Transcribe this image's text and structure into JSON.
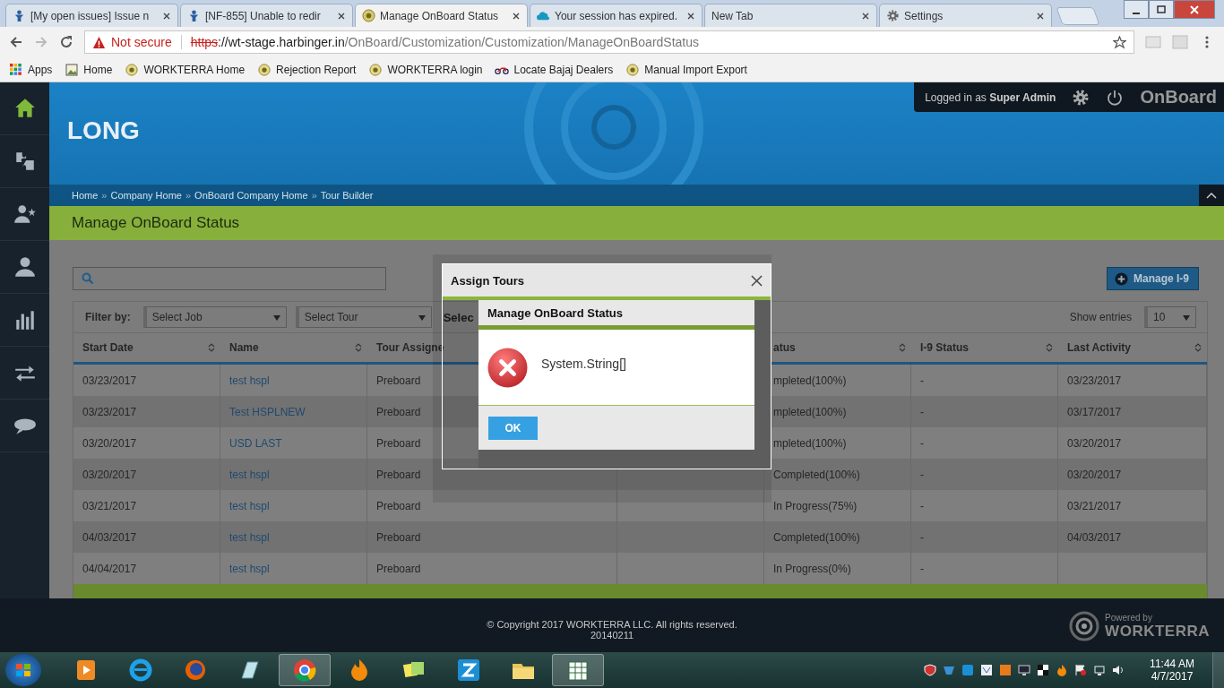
{
  "browser": {
    "tabs": [
      {
        "title": "[My open issues] Issue n",
        "kind": "figure",
        "selected": false
      },
      {
        "title": "[NF-855] Unable to redir",
        "kind": "figure",
        "selected": false
      },
      {
        "title": "Manage OnBoard Status",
        "kind": "logo",
        "selected": true
      },
      {
        "title": "Your session has expired.",
        "kind": "cloud",
        "selected": false
      },
      {
        "title": "New Tab",
        "kind": "plain",
        "selected": false
      },
      {
        "title": "Settings",
        "kind": "gear",
        "selected": false
      }
    ],
    "address": {
      "security": "Not secure",
      "scheme": "https",
      "host": "://wt-stage.harbinger.in",
      "path": "/OnBoard/Customization/Customization/ManageOnBoardStatus"
    },
    "bookmarks": [
      {
        "label": "Apps",
        "kind": "apps"
      },
      {
        "label": "Home",
        "kind": "page"
      },
      {
        "label": "WORKTERRA Home",
        "kind": "logo"
      },
      {
        "label": "Rejection Report",
        "kind": "logo"
      },
      {
        "label": "WORKTERRA login",
        "kind": "logo"
      },
      {
        "label": "Locate Bajaj Dealers",
        "kind": "bike"
      },
      {
        "label": "Manual Import Export",
        "kind": "logo"
      }
    ]
  },
  "sidebar": {
    "items": [
      {
        "kind": "home",
        "selected": true
      },
      {
        "kind": "puzzle",
        "selected": false
      },
      {
        "kind": "person-star",
        "selected": false
      },
      {
        "kind": "person",
        "selected": false
      },
      {
        "kind": "chart",
        "selected": false
      },
      {
        "kind": "arrows",
        "selected": false
      },
      {
        "kind": "chat",
        "selected": false
      }
    ]
  },
  "header": {
    "company": "LONG",
    "user_prefix": "Logged in as",
    "user": "Super Admin",
    "product": "OnBoard",
    "breadcrumbs": [
      "Home",
      "Company Home",
      "OnBoard Company Home",
      "Tour Builder"
    ],
    "separator": "»"
  },
  "page": {
    "title": "Manage OnBoard Status",
    "manage_button": "Manage I-9",
    "filter": {
      "label": "Filter by:",
      "selects": [
        "Select Job",
        "Select Tour",
        "Selec"
      ],
      "show_entries": "Show entries",
      "entries": "10"
    },
    "table": {
      "columns": [
        "Start Date",
        "Name",
        "Tour Assigne",
        "atus",
        "I-9 Status",
        "Last Activity"
      ],
      "rows": [
        {
          "start_date": "03/23/2017",
          "name": "test hspl",
          "tour": "Preboard",
          "status": "mpleted(100%)",
          "i9": "-",
          "last_activity": "03/23/2017"
        },
        {
          "start_date": "03/23/2017",
          "name": "Test HSPLNEW",
          "tour": "Preboard",
          "status": "mpleted(100%)",
          "i9": "-",
          "last_activity": "03/17/2017"
        },
        {
          "start_date": "03/20/2017",
          "name": "USD LAST",
          "tour": "Preboard",
          "status": "mpleted(100%)",
          "i9": "-",
          "last_activity": "03/20/2017"
        },
        {
          "start_date": "03/20/2017",
          "name": "test hspl",
          "tour": "Preboard",
          "status": "Completed(100%)",
          "i9": "-",
          "last_activity": "03/20/2017"
        },
        {
          "start_date": "03/21/2017",
          "name": "test hspl",
          "tour": "Preboard",
          "status": "In Progress(75%)",
          "i9": "-",
          "last_activity": "03/21/2017"
        },
        {
          "start_date": "04/03/2017",
          "name": "test hspl",
          "tour": "Preboard",
          "status": "Completed(100%)",
          "i9": "-",
          "last_activity": "04/03/2017"
        },
        {
          "start_date": "04/04/2017",
          "name": "test hspl",
          "tour": "Preboard",
          "status": "In Progress(0%)",
          "i9": "-"
        }
      ]
    }
  },
  "dialog": {
    "title": "Assign Tours",
    "inner": {
      "title": "Manage OnBoard Status",
      "message": "System.String[]",
      "button": "OK"
    }
  },
  "footer": {
    "copyright": "© Copyright 2017 WORKTERRA LLC. All rights reserved.",
    "build": "20140211",
    "powered_by": "Powered by",
    "brand": "WORKTERRA"
  },
  "taskbar": {
    "apps": [
      {
        "kind": "media",
        "selected": false
      },
      {
        "kind": "ie",
        "selected": false
      },
      {
        "kind": "firefox",
        "selected": false
      },
      {
        "kind": "notes",
        "selected": false
      },
      {
        "kind": "chrome",
        "selected": true
      },
      {
        "kind": "flame",
        "selected": false
      },
      {
        "kind": "stickies",
        "selected": false
      },
      {
        "kind": "zapp",
        "selected": false
      },
      {
        "kind": "folder",
        "selected": false
      },
      {
        "kind": "spreadsheet",
        "selected": true
      }
    ],
    "tray": [
      {
        "kind": "shield"
      },
      {
        "kind": "wing"
      },
      {
        "kind": "zapp"
      },
      {
        "kind": "wolf"
      },
      {
        "kind": "box"
      },
      {
        "kind": "monitor"
      },
      {
        "kind": "chess"
      },
      {
        "kind": "flame"
      },
      {
        "kind": "flag"
      },
      {
        "kind": "network"
      },
      {
        "kind": "speaker"
      }
    ],
    "time": "11:44 AM",
    "date": "4/7/2017"
  }
}
